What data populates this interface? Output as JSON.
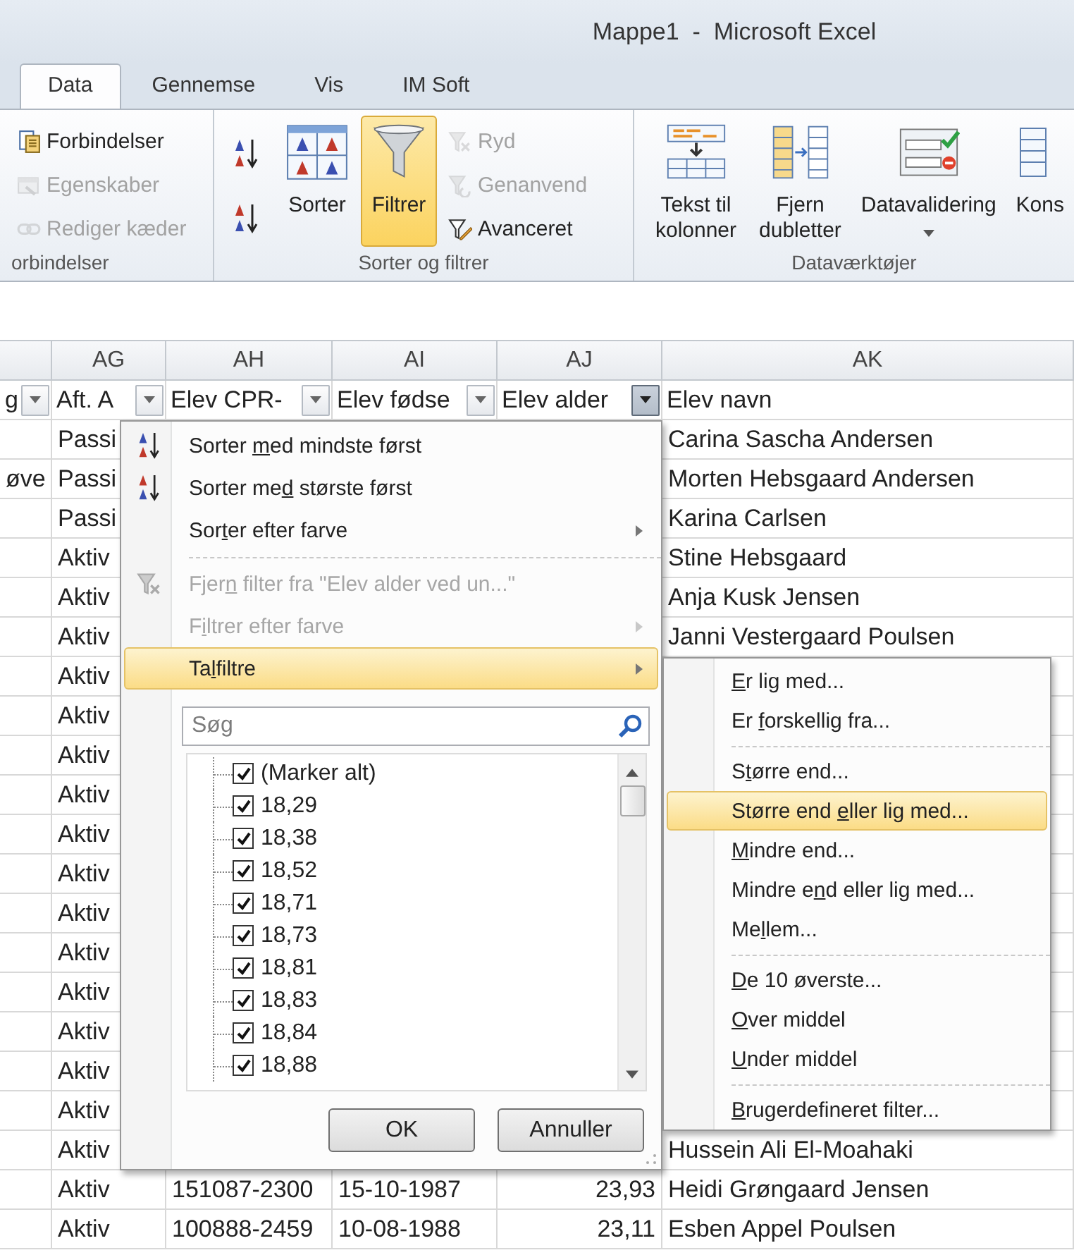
{
  "window": {
    "title": "Mappe1  -  Microsoft Excel"
  },
  "tabs": [
    {
      "label": "Data",
      "selected": true
    },
    {
      "label": "Gennemse",
      "selected": false
    },
    {
      "label": "Vis",
      "selected": false
    },
    {
      "label": "IM Soft",
      "selected": false
    }
  ],
  "ribbon": {
    "groups": [
      {
        "label": "orbindelser",
        "items": [
          {
            "kind": "small",
            "label": "Forbindelser",
            "disabled": false
          },
          {
            "kind": "small",
            "label": "Egenskaber",
            "disabled": true
          },
          {
            "kind": "small",
            "label": "Rediger kæder",
            "disabled": true
          }
        ]
      },
      {
        "label": "Sorter og filtrer",
        "items": [
          {
            "kind": "icon",
            "disabled": false
          },
          {
            "kind": "icon",
            "disabled": false
          },
          {
            "kind": "big",
            "label": "Sorter",
            "pressed": false
          },
          {
            "kind": "big",
            "label": "Filtrer",
            "pressed": true
          },
          {
            "kind": "small",
            "label": "Ryd",
            "disabled": true
          },
          {
            "kind": "small",
            "label": "Genanvend",
            "disabled": true
          },
          {
            "kind": "small",
            "label": "Avanceret",
            "disabled": false
          }
        ]
      },
      {
        "label": "Dataværktøjer",
        "items": [
          {
            "kind": "big",
            "label": "Tekst til kolonner",
            "pressed": false
          },
          {
            "kind": "big",
            "label": "Fjern dubletter",
            "pressed": false
          },
          {
            "kind": "big",
            "label": "Datavalidering",
            "pressed": false,
            "dropdown": true
          },
          {
            "kind": "big",
            "label": "Kons",
            "pressed": false
          }
        ]
      }
    ]
  },
  "sheet": {
    "columns": [
      "AG",
      "AH",
      "AI",
      "AJ",
      "AK"
    ],
    "header_cells": [
      {
        "text": "g",
        "filter_button": true,
        "filter_open": false
      },
      {
        "text": "Aft. A",
        "filter_button": true,
        "filter_open": false
      },
      {
        "text": "Elev CPR-",
        "filter_button": true,
        "filter_open": false
      },
      {
        "text": "Elev fødse",
        "filter_button": true,
        "filter_open": false
      },
      {
        "text": "Elev alder",
        "filter_button": true,
        "filter_open": true
      },
      {
        "text": "Elev navn",
        "filter_button": false
      }
    ],
    "rows": [
      {
        "ag": "Passi",
        "ak": "Carina Sascha Andersen"
      },
      {
        "c0": "øve",
        "ag": "Passi",
        "ak": "Morten Hebsgaard Andersen"
      },
      {
        "ag": "Passi",
        "ak": "Karina Carlsen"
      },
      {
        "ag": "Aktiv",
        "ak": "Stine Hebsgaard"
      },
      {
        "ag": "Aktiv",
        "ak": "Anja Kusk Jensen"
      },
      {
        "ag": "Aktiv",
        "ak": "Janni Vestergaard Poulsen"
      },
      {
        "ag": "Aktiv"
      },
      {
        "ag": "Aktiv"
      },
      {
        "ag": "Aktiv"
      },
      {
        "ag": "Aktiv"
      },
      {
        "ag": "Aktiv"
      },
      {
        "ag": "Aktiv"
      },
      {
        "ag": "Aktiv"
      },
      {
        "ag": "Aktiv"
      },
      {
        "ag": "Aktiv"
      },
      {
        "ag": "Aktiv"
      },
      {
        "ag": "Aktiv"
      },
      {
        "ag": "Aktiv"
      },
      {
        "ag": "Aktiv",
        "ak": "Hussein Ali El-Moahaki"
      },
      {
        "ag": "Aktiv",
        "ah": "151087-2300",
        "ai": "15-10-1987",
        "aj": "23,93",
        "ak": "Heidi Grøngaard Jensen"
      },
      {
        "ag": "Aktiv",
        "ah": "100888-2459",
        "ai": "10-08-1988",
        "aj": "23,11",
        "ak": "Esben Appel Poulsen"
      }
    ]
  },
  "filter_menu": {
    "items": [
      {
        "kind": "item",
        "label": [
          {
            "text": "Sorter ",
            "underline": false
          },
          {
            "text": "m",
            "underline": true
          },
          {
            "text": "ed mindste først",
            "underline": false
          }
        ],
        "disabled": false,
        "selected": false,
        "submenu": false
      },
      {
        "kind": "item",
        "label": [
          {
            "text": "Sorter me",
            "underline": false
          },
          {
            "text": "d",
            "underline": true
          },
          {
            "text": " største først",
            "underline": false
          }
        ],
        "disabled": false,
        "selected": false,
        "submenu": false
      },
      {
        "kind": "item",
        "label": [
          {
            "text": "Sor",
            "underline": false
          },
          {
            "text": "t",
            "underline": true
          },
          {
            "text": "er efter farve",
            "underline": false
          }
        ],
        "disabled": false,
        "selected": false,
        "submenu": true
      },
      {
        "kind": "separator"
      },
      {
        "kind": "item",
        "label": [
          {
            "text": "Fjer",
            "underline": false
          },
          {
            "text": "n",
            "underline": true
          },
          {
            "text": " filter fra \"Elev alder ved un...\"",
            "underline": false
          }
        ],
        "disabled": true,
        "selected": false,
        "submenu": false
      },
      {
        "kind": "item",
        "label": [
          {
            "text": "F",
            "underline": false
          },
          {
            "text": "i",
            "underline": true
          },
          {
            "text": "ltrer efter farve",
            "underline": false
          }
        ],
        "disabled": true,
        "selected": false,
        "submenu": true
      },
      {
        "kind": "item",
        "label": [
          {
            "text": "Ta",
            "underline": false
          },
          {
            "text": "l",
            "underline": true
          },
          {
            "text": "filtre",
            "underline": false
          }
        ],
        "disabled": false,
        "selected": true,
        "submenu": true
      }
    ],
    "search": {
      "placeholder": "Søg"
    },
    "values": [
      {
        "label": "(Marker alt)",
        "checked": true
      },
      {
        "label": "18,29",
        "checked": true
      },
      {
        "label": "18,38",
        "checked": true
      },
      {
        "label": "18,52",
        "checked": true
      },
      {
        "label": "18,71",
        "checked": true
      },
      {
        "label": "18,73",
        "checked": true
      },
      {
        "label": "18,81",
        "checked": true
      },
      {
        "label": "18,83",
        "checked": true
      },
      {
        "label": "18,84",
        "checked": true
      },
      {
        "label": "18,88",
        "checked": true
      }
    ],
    "buttons": [
      "OK",
      "Annuller"
    ]
  },
  "number_filter_menu": {
    "items": [
      {
        "kind": "item",
        "label": [
          {
            "text": "E",
            "underline": true
          },
          {
            "text": "r lig med...",
            "underline": false
          }
        ],
        "selected": false
      },
      {
        "kind": "item",
        "label": [
          {
            "text": "Er ",
            "underline": false
          },
          {
            "text": "f",
            "underline": true
          },
          {
            "text": "orskellig fra...",
            "underline": false
          }
        ],
        "selected": false
      },
      {
        "kind": "separator"
      },
      {
        "kind": "item",
        "label": [
          {
            "text": "S",
            "underline": false
          },
          {
            "text": "t",
            "underline": true
          },
          {
            "text": "ørre end...",
            "underline": false
          }
        ],
        "selected": false
      },
      {
        "kind": "item",
        "label": [
          {
            "text": "Større end ",
            "underline": false
          },
          {
            "text": "e",
            "underline": true
          },
          {
            "text": "ller lig med...",
            "underline": false
          }
        ],
        "selected": true
      },
      {
        "kind": "item",
        "label": [
          {
            "text": "M",
            "underline": true
          },
          {
            "text": "indre end...",
            "underline": false
          }
        ],
        "selected": false
      },
      {
        "kind": "item",
        "label": [
          {
            "text": "Mindre e",
            "underline": false
          },
          {
            "text": "n",
            "underline": true
          },
          {
            "text": "d eller lig med...",
            "underline": false
          }
        ],
        "selected": false
      },
      {
        "kind": "item",
        "label": [
          {
            "text": "Me",
            "underline": false
          },
          {
            "text": "l",
            "underline": true
          },
          {
            "text": "lem...",
            "underline": false
          }
        ],
        "selected": false
      },
      {
        "kind": "separator"
      },
      {
        "kind": "item",
        "label": [
          {
            "text": "D",
            "underline": true
          },
          {
            "text": "e 10 øverste...",
            "underline": false
          }
        ],
        "selected": false
      },
      {
        "kind": "item",
        "label": [
          {
            "text": "O",
            "underline": true
          },
          {
            "text": "ver middel",
            "underline": false
          }
        ],
        "selected": false
      },
      {
        "kind": "item",
        "label": [
          {
            "text": "U",
            "underline": true
          },
          {
            "text": "nder middel",
            "underline": false
          }
        ],
        "selected": false
      },
      {
        "kind": "separator"
      },
      {
        "kind": "item",
        "label": [
          {
            "text": "B",
            "underline": true
          },
          {
            "text": "rugerdefineret filter...",
            "underline": false
          }
        ],
        "selected": false
      }
    ]
  }
}
